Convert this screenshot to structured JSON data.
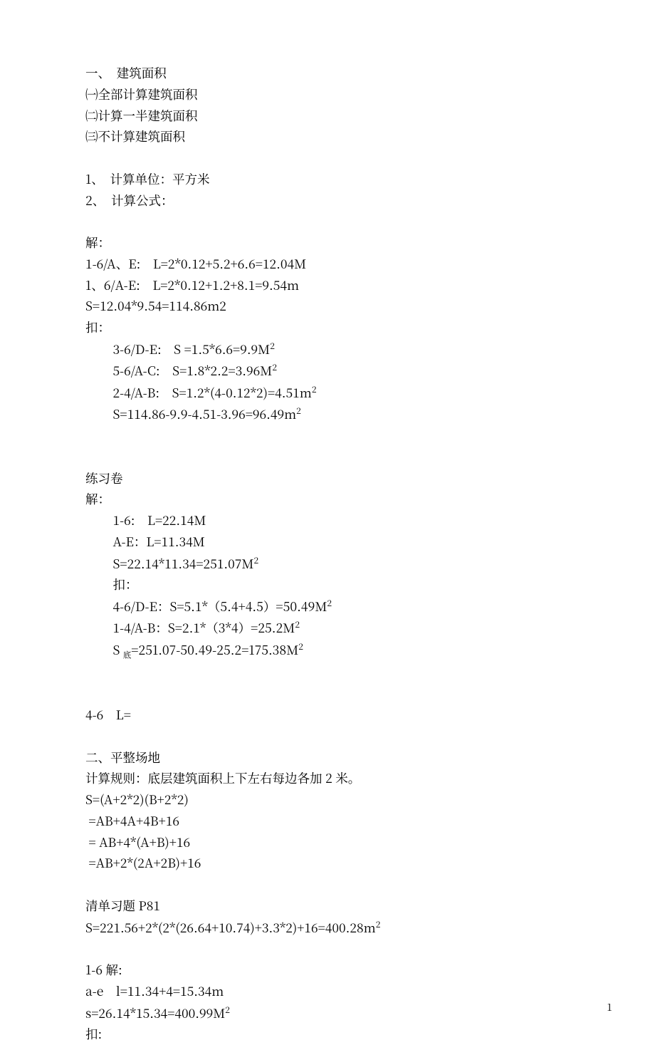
{
  "section1": {
    "title": "一、　建筑面积",
    "sub1": "㈠全部计算建筑面积",
    "sub2": "㈡计算一半建筑面积",
    "sub3": "㈢不计算建筑面积",
    "item1": "1、　计算单位：平方米",
    "item2": "2、　计算公式："
  },
  "solution1": {
    "header": "解：",
    "l1": "1-6/A、E:　L=2*0.12+5.2+6.6=12.04M",
    "l2": "1、6/A-E:　L=2*0.12+1.2+8.1=9.54m",
    "l3": "S=12.04*9.54=114.86m2",
    "deduct": "扣：",
    "d1": "3-6/D-E:　S =1.5*6.6=9.9M",
    "d2": "5-6/A-C:　S=1.8*2.2=3.96M",
    "d3": "2-4/A-B:　S=1.2*(4-0.12*2)=4.51m",
    "d4": "S=114.86-9.9-4.51-3.96=96.49m"
  },
  "practice": {
    "title": "练习卷",
    "header": "解：",
    "l1": "1-6:　L=22.14M",
    "l2": "A-E：L=11.34M",
    "l3": "S=22.14*11.34=251.07M",
    "deduct": "扣：",
    "d1": "4-6/D-E：S=5.1*（5.4+4.5）=50.49M",
    "d2": "1-4/A-B：S=2.1*（3*4）=25.2M",
    "d3a": "S ",
    "d3sub": "底",
    "d3b": "=251.07-50.49-25.2=175.38M"
  },
  "line46": "4-6　L=",
  "section2": {
    "title": "二、平整场地",
    "rule": "计算规则：底层建筑面积上下左右每边各加 2 米。",
    "eq1": "S=(A+2*2)(B+2*2)",
    "eq2": " =AB+4A+4B+16",
    "eq3": " = AB+4*(A+B)+16",
    "eq4": " =AB+2*(2A+2B)+16"
  },
  "qingdan": {
    "title": "清单习题 P81",
    "eq": "S=221.56+2*(2*(26.64+10.74)+3.3*2)+16=400.28m"
  },
  "sol16": {
    "header": "1-6 解:",
    "l1": "a-e　l=11.34+4=15.34m",
    "l2": "s=26.14*15.34=400.99M",
    "deduct": "扣:"
  },
  "pageNumber": "1"
}
